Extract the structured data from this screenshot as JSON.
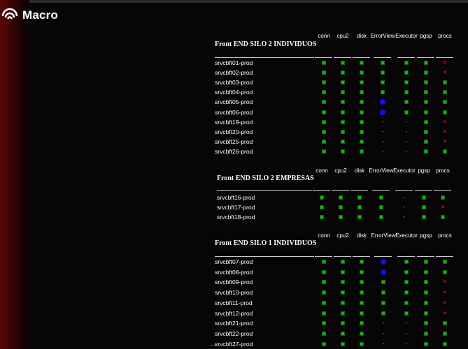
{
  "brand": {
    "name": "Macro",
    "logo_icon": "macro-logo-icon"
  },
  "colors": {
    "ok": "#17b21a",
    "error_view": "#1010e6",
    "fail": "#e01616",
    "sidebar": "#5a0606"
  },
  "columns": [
    "conn",
    "cpu2",
    "disk",
    "ErrorView",
    "Executor",
    "pgsp",
    "procs"
  ],
  "sections": [
    {
      "title": "Front END SILO 2 INDIVIDUOS",
      "rows": [
        {
          "host": "srvcbft01-prod",
          "status": [
            "ok",
            "ok",
            "ok",
            "ok",
            "ok",
            "ok",
            "x"
          ]
        },
        {
          "host": "srvcbft02-prod",
          "status": [
            "ok",
            "ok",
            "ok",
            "ok",
            "ok",
            "ok",
            "x"
          ]
        },
        {
          "host": "srvcbft03-prod",
          "status": [
            "ok",
            "ok",
            "ok",
            "ok",
            "ok",
            "ok",
            "ok"
          ]
        },
        {
          "host": "srvcbft04-prod",
          "status": [
            "ok",
            "ok",
            "ok",
            "ok",
            "ok",
            "ok",
            "ok"
          ]
        },
        {
          "host": "srvcbft05-prod",
          "status": [
            "ok",
            "ok",
            "ok",
            "dot",
            "ok",
            "ok",
            "ok"
          ]
        },
        {
          "host": "srvcbft06-prod",
          "status": [
            "ok",
            "ok",
            "ok",
            "dot",
            "ok",
            "ok",
            "ok"
          ]
        },
        {
          "host": "srvcbft19-prod",
          "status": [
            "ok",
            "ok",
            "ok",
            "-",
            "-",
            "ok",
            "x"
          ]
        },
        {
          "host": "srvcbft20-prod",
          "status": [
            "ok",
            "ok",
            "ok",
            "-",
            "-",
            "ok",
            "x"
          ]
        },
        {
          "host": "srvcbft25-prod",
          "status": [
            "ok",
            "ok",
            "ok",
            "-",
            "-",
            "ok",
            "x"
          ]
        },
        {
          "host": "srvcbft26-prod",
          "status": [
            "ok",
            "ok",
            "ok",
            "-",
            "-",
            "ok",
            "ok"
          ]
        }
      ]
    },
    {
      "title": "Front END SILO 2 EMPRESAS",
      "rows": [
        {
          "host": "srvcbft16-prod",
          "status": [
            "ok",
            "ok",
            "ok",
            "ok",
            "-",
            "ok",
            "ok"
          ]
        },
        {
          "host": "srvcbft17-prod",
          "status": [
            "ok",
            "ok",
            "ok",
            "ok",
            "-",
            "ok",
            "x"
          ]
        },
        {
          "host": "srvcbft18-prod",
          "status": [
            "ok",
            "ok",
            "ok",
            "ok",
            "-",
            "ok",
            "ok"
          ]
        }
      ]
    },
    {
      "title": "Front END SILO 1 INDIVIDUOS",
      "rows": [
        {
          "host": "srvcbft07-prod",
          "status": [
            "ok",
            "ok",
            "ok",
            "dot",
            "ok",
            "ok",
            "ok"
          ]
        },
        {
          "host": "srvcbft08-prod",
          "status": [
            "ok",
            "ok",
            "ok",
            "dot",
            "ok",
            "ok",
            "ok"
          ]
        },
        {
          "host": "srvcbft09-prod",
          "status": [
            "ok",
            "ok",
            "ok",
            "ok",
            "ok",
            "ok",
            "x"
          ]
        },
        {
          "host": "srvcbft10-prod",
          "status": [
            "ok",
            "ok",
            "ok",
            "ok",
            "ok",
            "ok",
            "x"
          ]
        },
        {
          "host": "srvcbft11-prod",
          "status": [
            "ok",
            "ok",
            "ok",
            "ok",
            "ok",
            "ok",
            "x"
          ]
        },
        {
          "host": "srvcbft12-prod",
          "status": [
            "ok",
            "ok",
            "ok",
            "ok",
            "ok",
            "ok",
            "x"
          ]
        },
        {
          "host": "srvcbft21-prod",
          "status": [
            "ok",
            "ok",
            "ok",
            "-",
            "-",
            "ok",
            "ok"
          ]
        },
        {
          "host": "srvcbft22-prod",
          "status": [
            "ok",
            "ok",
            "ok",
            "-",
            "-",
            "ok",
            "ok"
          ]
        },
        {
          "host": "srvcbft27-prod",
          "status": [
            "ok",
            "ok",
            "ok",
            "-",
            "-",
            "ok",
            "ok"
          ]
        }
      ]
    }
  ]
}
